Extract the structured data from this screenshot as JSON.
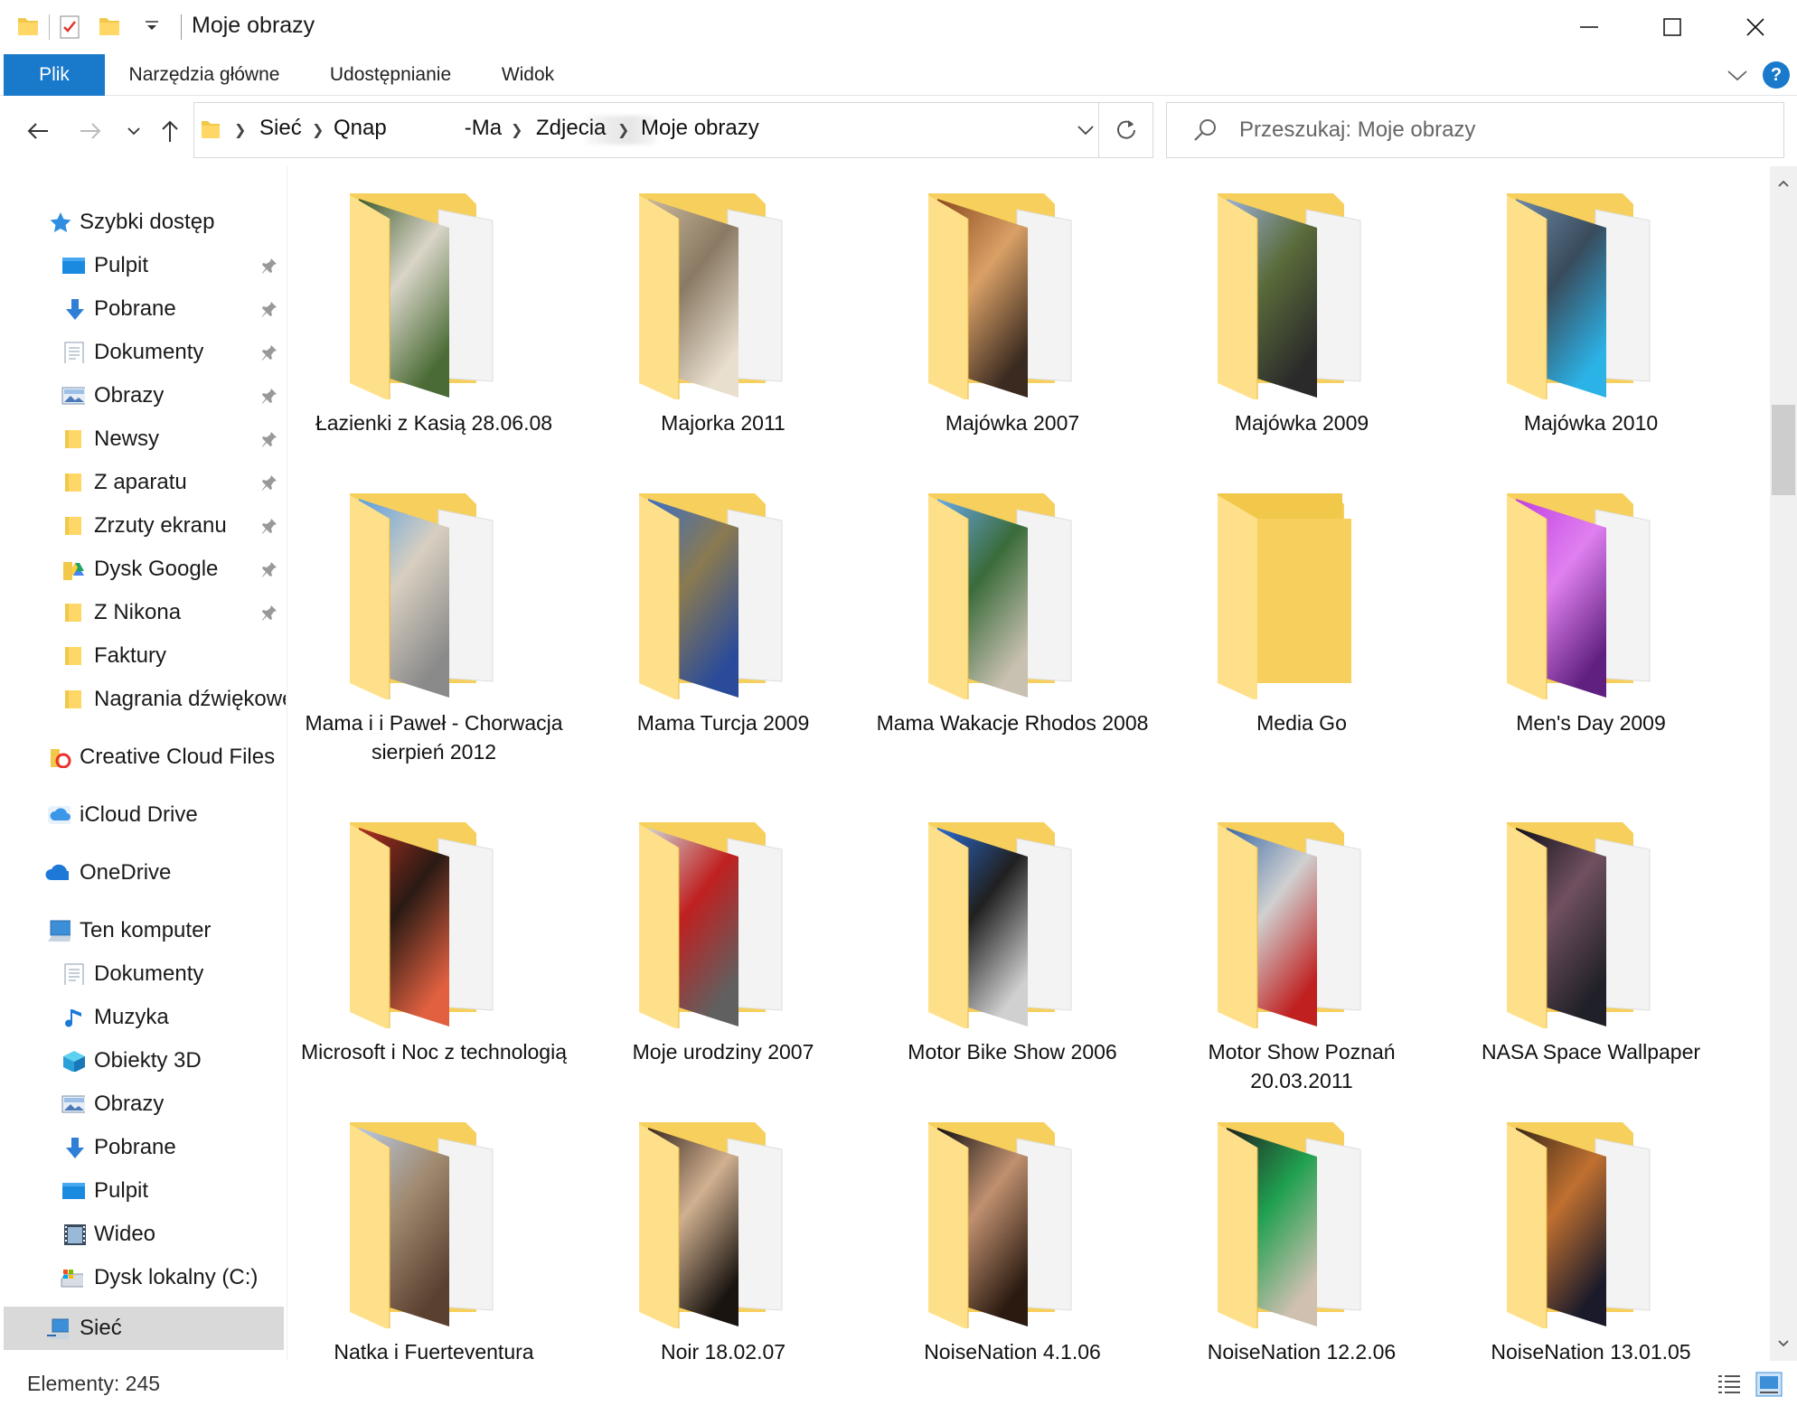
{
  "window": {
    "title": "Moje obrazy",
    "minimize_label": "Minimalizuj",
    "maximize_label": "Maksymalizuj",
    "close_label": "Zamknij"
  },
  "ribbon": {
    "tabs": [
      {
        "label": "Plik",
        "active": true
      },
      {
        "label": "Narzędzia główne",
        "active": false
      },
      {
        "label": "Udostępnianie",
        "active": false
      },
      {
        "label": "Widok",
        "active": false
      }
    ],
    "help_label": "?"
  },
  "address": {
    "crumbs": [
      "Sieć",
      "Qnap",
      "-Ma",
      "Zdjecia",
      "Moje obrazy"
    ]
  },
  "search": {
    "placeholder": "Przeszukaj: Moje obrazy"
  },
  "sidebar": {
    "quick_access": {
      "label": "Szybki dostęp",
      "icon": "star-icon"
    },
    "pinned": [
      {
        "label": "Pulpit",
        "icon": "desktop-icon"
      },
      {
        "label": "Pobrane",
        "icon": "download-icon"
      },
      {
        "label": "Dokumenty",
        "icon": "document-icon"
      },
      {
        "label": "Obrazy",
        "icon": "pictures-icon"
      },
      {
        "label": "Newsy",
        "icon": "folder-icon"
      },
      {
        "label": "Z aparatu",
        "icon": "folder-icon"
      },
      {
        "label": "Zrzuty ekranu",
        "icon": "folder-icon"
      },
      {
        "label": "Dysk Google",
        "icon": "google-drive-icon"
      },
      {
        "label": "Z Nikona",
        "icon": "folder-icon"
      }
    ],
    "unpinned": [
      {
        "label": "Faktury",
        "icon": "folder-icon"
      },
      {
        "label": "Nagrania dźwiękowe",
        "icon": "folder-icon"
      }
    ],
    "creative_cloud": {
      "label": "Creative Cloud Files",
      "icon": "creative-cloud-icon"
    },
    "icloud": {
      "label": "iCloud Drive",
      "icon": "icloud-icon"
    },
    "onedrive": {
      "label": "OneDrive",
      "icon": "onedrive-icon"
    },
    "this_pc": {
      "label": "Ten komputer",
      "icon": "computer-icon"
    },
    "this_pc_items": [
      {
        "label": "Dokumenty",
        "icon": "document-icon"
      },
      {
        "label": "Muzyka",
        "icon": "music-icon"
      },
      {
        "label": "Obiekty 3D",
        "icon": "cube-3d-icon"
      },
      {
        "label": "Obrazy",
        "icon": "pictures-icon"
      },
      {
        "label": "Pobrane",
        "icon": "download-icon"
      },
      {
        "label": "Pulpit",
        "icon": "desktop-icon"
      },
      {
        "label": "Wideo",
        "icon": "video-icon"
      },
      {
        "label": "Dysk lokalny (C:)",
        "icon": "local-disk-icon"
      }
    ],
    "network": {
      "label": "Sieć",
      "icon": "network-icon",
      "selected": true
    }
  },
  "folders": [
    {
      "label": "Łazienki z Kasią 28.06.08",
      "thumb": [
        "#3d5a2a",
        "#d9d5c8",
        "#4a6b35"
      ]
    },
    {
      "label": "Majorka 2011",
      "thumb": [
        "#c9b89a",
        "#8a7a64",
        "#e9dfcf"
      ]
    },
    {
      "label": "Majówka 2007",
      "thumb": [
        "#8b4a1e",
        "#d9a066",
        "#3a2a20"
      ]
    },
    {
      "label": "Majówka 2009",
      "thumb": [
        "#9ab0d6",
        "#5a6b3a",
        "#2a2a2a"
      ]
    },
    {
      "label": "Majówka 2010",
      "thumb": [
        "#6d8aa6",
        "#394b5c",
        "#2bb3e8"
      ]
    },
    {
      "label": "Mama i i Paweł - Chorwacja sierpień 2012",
      "thumb": [
        "#5aa0e0",
        "#d8cfc0",
        "#8a8a8a"
      ]
    },
    {
      "label": "Mama Turcja 2009",
      "thumb": [
        "#3b6ec4",
        "#8a7a50",
        "#2a4b9a"
      ]
    },
    {
      "label": "Mama Wakacje Rhodos 2008",
      "thumb": [
        "#6aa8e8",
        "#3a6b3a",
        "#c8c0b0"
      ]
    },
    {
      "label": "Media Go",
      "thumb": []
    },
    {
      "label": "Men's Day 2009",
      "thumb": [
        "#c040e0",
        "#e080f0",
        "#602080"
      ]
    },
    {
      "label": "Microsoft i Noc z technologią",
      "thumb": [
        "#b03020",
        "#2a1a14",
        "#e06040"
      ]
    },
    {
      "label": "Moje urodziny 2007",
      "thumb": [
        "#d0d0d0",
        "#c02020",
        "#606060"
      ]
    },
    {
      "label": "Motor Bike Show 2006",
      "thumb": [
        "#2a6ad0",
        "#202020",
        "#d0d0d0"
      ]
    },
    {
      "label": "Motor Show Poznań 20.03.2011",
      "thumb": [
        "#3a6aa8",
        "#d0d0d0",
        "#c02020"
      ]
    },
    {
      "label": "NASA Space Wallpaper",
      "thumb": [
        "#101018",
        "#705060",
        "#202028"
      ]
    },
    {
      "label": "Natka i Fuerteventura",
      "thumb": [
        "#b8c8e0",
        "#a08a70",
        "#5a4030"
      ]
    },
    {
      "label": "Noir 18.02.07",
      "thumb": [
        "#3a2820",
        "#d0b090",
        "#1a1410"
      ]
    },
    {
      "label": "NoiseNation 4.1.06",
      "thumb": [
        "#101010",
        "#c09070",
        "#2a1a10"
      ]
    },
    {
      "label": "NoiseNation 12.2.06",
      "thumb": [
        "#202020",
        "#20a050",
        "#d0c0b0"
      ]
    },
    {
      "label": "NoiseNation 13.01.05",
      "thumb": [
        "#3a2a18",
        "#c07030",
        "#1a1a2a"
      ]
    }
  ],
  "status": {
    "count_text": "Elementy: 245"
  }
}
